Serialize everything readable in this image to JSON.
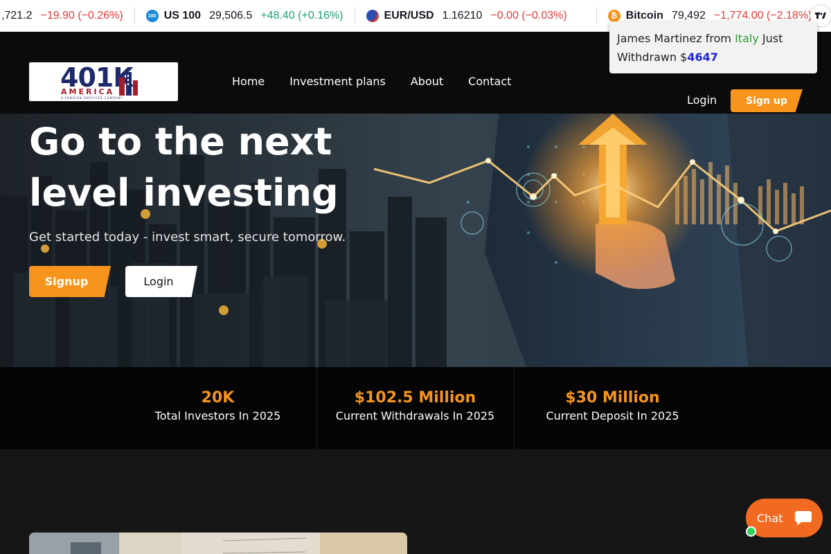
{
  "ticker": {
    "items": [
      {
        "name": "",
        "value": ",721.2",
        "change": "−19.90 (−0.26%)",
        "dir": "neg",
        "logo": "",
        "logo_color": ""
      },
      {
        "name": "US 100",
        "value": "29,506.5",
        "change": "+48.40 (+0.16%)",
        "dir": "pos",
        "logo": "100",
        "logo_color": "#1c8ad9"
      },
      {
        "name": "EUR/USD",
        "value": "1.16210",
        "change": "−0.00 (−0.03%)",
        "dir": "neg",
        "logo": "",
        "logo_color": "#2b4fb0"
      },
      {
        "name": "Bitcoin",
        "value": "79,492",
        "change": "−1,774.00 (−2.18%)",
        "dir": "neg",
        "logo": "₿",
        "logo_color": "#f7931a"
      }
    ],
    "badge": "TV"
  },
  "notification": {
    "name": "James Martinez from ",
    "country": "Italy",
    "action": " Just Withdrawn $",
    "amount": "4647"
  },
  "header": {
    "logo_main": "401K",
    "logo_sub": "AMERICA",
    "logo_tag": "A PENSION SERVICES COMPANY",
    "nav": [
      "Home",
      "Investment plans",
      "About",
      "Contact"
    ],
    "login": "Login",
    "signup": "Sign up"
  },
  "hero": {
    "title": "Go to the next level investing",
    "subtitle": "Get started today - invest smart, secure tomorrow.",
    "signup": "Signup",
    "login": "Login"
  },
  "stats": [
    {
      "value": "20K",
      "label": "Total Investors In 2025"
    },
    {
      "value": "$102.5 Million",
      "label": "Current Withdrawals In 2025"
    },
    {
      "value": "$30 Million",
      "label": "Current Deposit In 2025"
    }
  ],
  "chat": {
    "label": "Chat"
  },
  "colors": {
    "accent": "#f7941d",
    "chat": "#f26a21",
    "online": "#2bd35b"
  },
  "icons": [
    "us100-icon",
    "eur-usd-icon",
    "bitcoin-icon",
    "tradingview-icon",
    "chat-bubble-icon"
  ]
}
